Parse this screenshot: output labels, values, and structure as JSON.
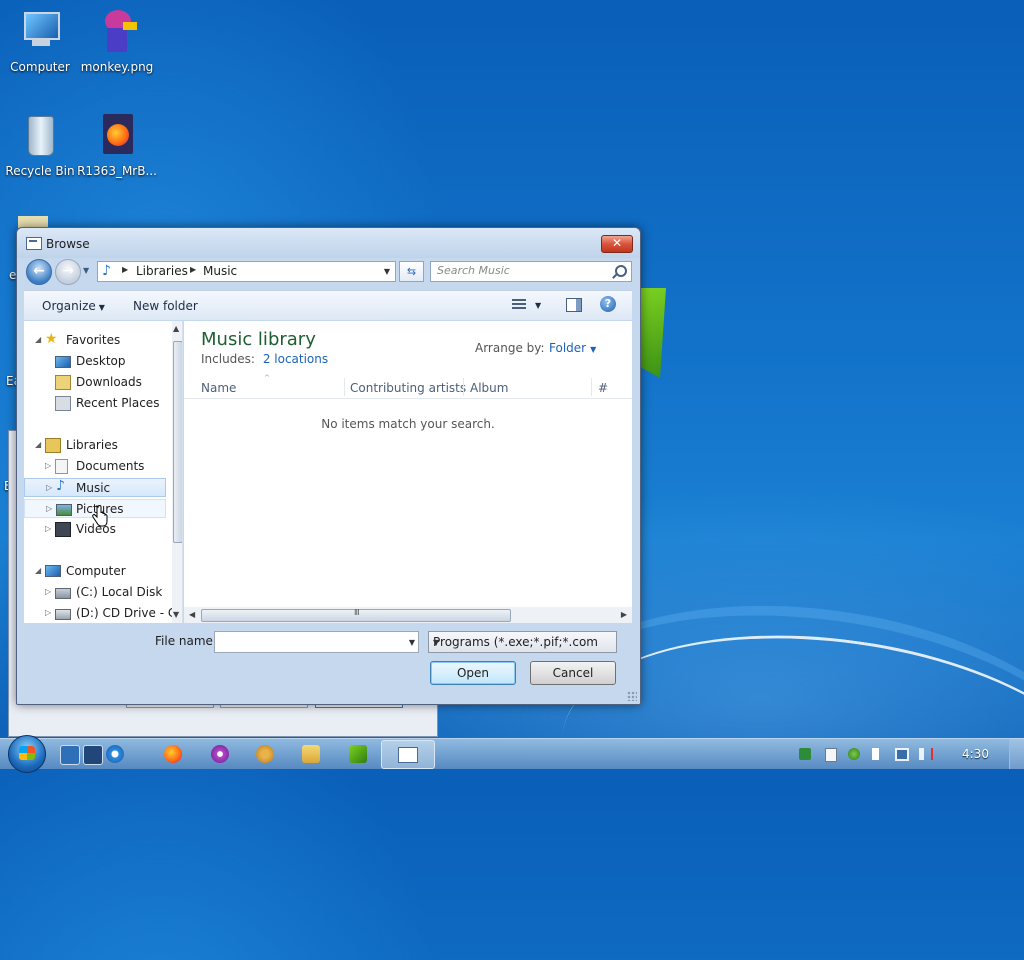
{
  "desktop": {
    "icons": [
      {
        "label": "Computer"
      },
      {
        "label": "monkey.png"
      },
      {
        "label": "Recycle Bin"
      },
      {
        "label": "R1363_MrB..."
      }
    ],
    "partial_labels": [
      "e",
      "Ea",
      "En"
    ]
  },
  "dialog": {
    "title": "Browse",
    "close_glyph": "✕",
    "address": {
      "crumbs": [
        "Libraries",
        "Music"
      ]
    },
    "search": {
      "placeholder": "Search Music"
    },
    "toolbar": {
      "organize": "Organize",
      "new_folder": "New folder"
    },
    "nav": {
      "items": [
        {
          "label": "Favorites",
          "icon": "star-icon"
        },
        {
          "label": "Desktop",
          "icon": "desktop-icon"
        },
        {
          "label": "Downloads",
          "icon": "downloads-icon"
        },
        {
          "label": "Recent Places",
          "icon": "recent-places-icon"
        },
        {
          "label": "Libraries",
          "icon": "libraries-icon"
        },
        {
          "label": "Documents",
          "icon": "documents-icon"
        },
        {
          "label": "Music",
          "icon": "music-icon"
        },
        {
          "label": "Pictures",
          "icon": "pictures-icon"
        },
        {
          "label": "Videos",
          "icon": "videos-icon"
        },
        {
          "label": "Computer",
          "icon": "computer-icon"
        },
        {
          "label": "(C:) Local Disk",
          "icon": "local-disk-icon"
        },
        {
          "label": "(D:) CD Drive - Cl",
          "icon": "cd-drive-icon"
        }
      ],
      "selected": "Music"
    },
    "library": {
      "title": "Music library",
      "includes_label": "Includes:",
      "includes_link": "2 locations",
      "arrange_label": "Arrange by:",
      "arrange_value": "Folder"
    },
    "columns": [
      "Name",
      "Contributing artists",
      "Album",
      "#"
    ],
    "empty_message": "No items match your search.",
    "file_name": {
      "label": "File name:",
      "value": ""
    },
    "file_type": "Programs (*.exe;*.pif;*.com;*.bat)",
    "buttons": {
      "open": "Open",
      "cancel": "Cancel"
    }
  },
  "taskbar": {
    "clock": "4:30"
  },
  "colors": {
    "accent": "#1c63b7",
    "library_title": "#1e5f32",
    "close_red": "#d8543b"
  }
}
